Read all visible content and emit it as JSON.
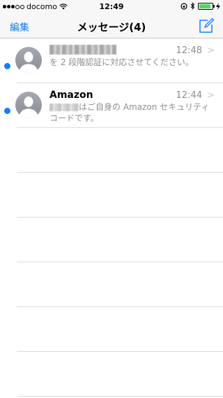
{
  "status_bar": {
    "carrier": "docomo",
    "time": "12:49",
    "battery_level": 0.9
  },
  "nav": {
    "edit_label": "編集",
    "title": "メッセージ(4)"
  },
  "messages": [
    {
      "sender": "",
      "time": "12:48",
      "preview": "を 2 段階認証に対応させてください。",
      "unread": true
    },
    {
      "sender": "Amazon",
      "time": "12:44",
      "preview": "はご自身の Amazon セキュリティコードです。",
      "unread": true
    }
  ],
  "colors": {
    "accent": "#157efb",
    "secondary_text": "#8e8e93",
    "separator": "#dcdcdc"
  }
}
